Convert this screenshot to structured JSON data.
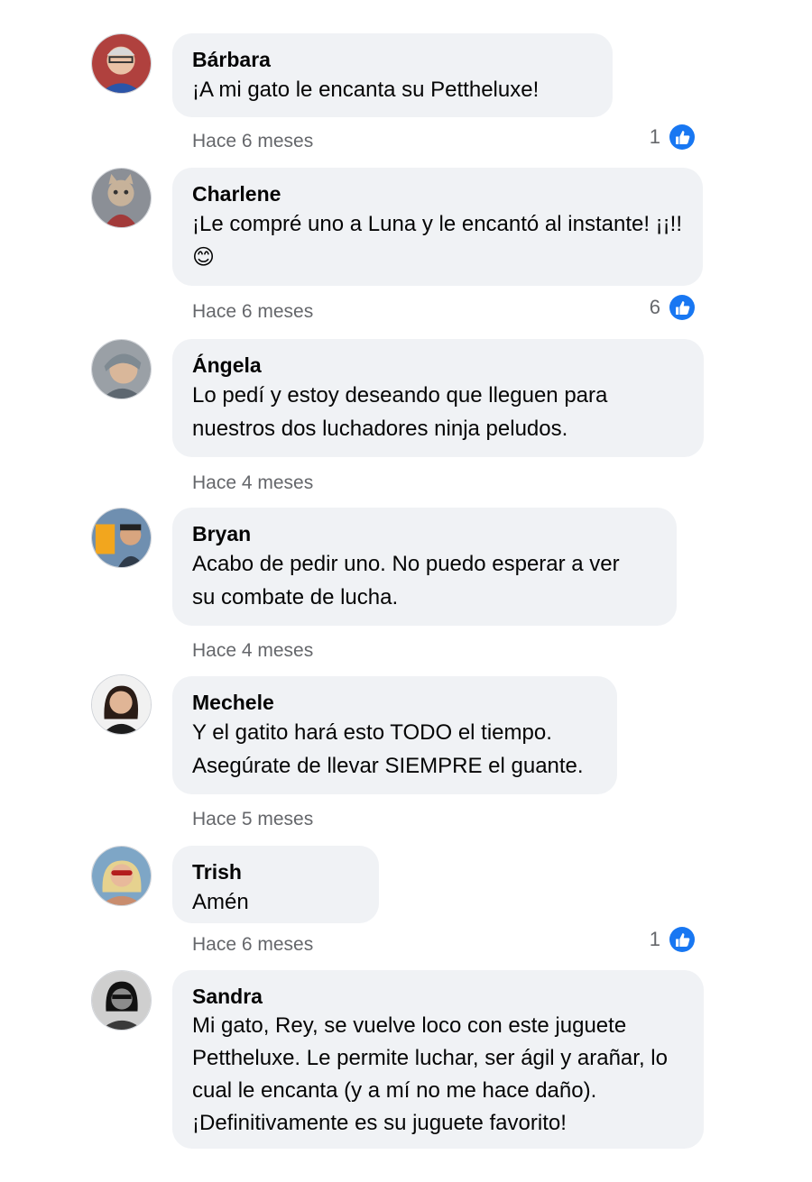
{
  "comments": [
    {
      "author": "Bárbara",
      "text": "¡A mi gato le encanta su Pettheluxe!",
      "time": "Hace 6 meses",
      "likes": "1"
    },
    {
      "author": "Charlene",
      "text": "¡Le compré uno a Luna y le encantó al instante! ¡¡!!😊",
      "time": "Hace 6 meses",
      "likes": "6"
    },
    {
      "author": "Ángela",
      "text": "Lo pedí y estoy deseando que lleguen para nuestros dos luchadores ninja peludos.",
      "time": "Hace 4 meses",
      "likes": ""
    },
    {
      "author": "Bryan",
      "text": "Acabo de pedir uno. No puedo esperar a ver su combate de lucha.",
      "time": "Hace 4 meses",
      "likes": ""
    },
    {
      "author": "Mechele",
      "text": "Y el gatito hará esto TODO el tiempo. Asegúrate de llevar SIEMPRE el guante.",
      "time": "Hace 5 meses",
      "likes": ""
    },
    {
      "author": "Trish",
      "text": "Amén",
      "time": "Hace 6 meses",
      "likes": "1"
    },
    {
      "author": "Sandra",
      "text": "Mi gato, Rey, se vuelve loco con este juguete Pettheluxe. Le permite luchar, ser ágil y arañar, lo cual le encanta (y a mí no me hace daño). ¡Definitivamente es su juguete favorito!",
      "time": "",
      "likes": ""
    }
  ],
  "icons": {
    "like": "thumbs-up-icon"
  },
  "colors": {
    "like_blue": "#1877f2",
    "bubble_bg": "#f0f2f5",
    "meta_gray": "#65676b"
  }
}
